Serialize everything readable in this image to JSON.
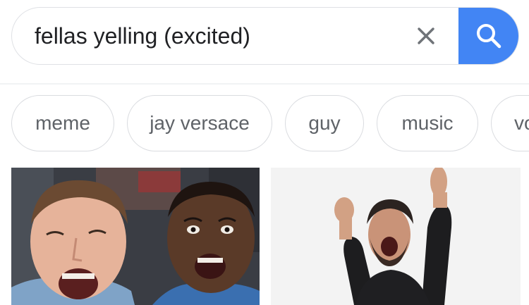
{
  "search": {
    "query": "fellas yelling (excited)"
  },
  "chips": [
    "meme",
    "jay versace",
    "guy",
    "music",
    "vo"
  ],
  "icons": {
    "clear": "close-icon",
    "search": "search-icon"
  },
  "colors": {
    "search_button": "#4285f4",
    "chip_text": "#5f6368",
    "query_text": "#202124"
  }
}
